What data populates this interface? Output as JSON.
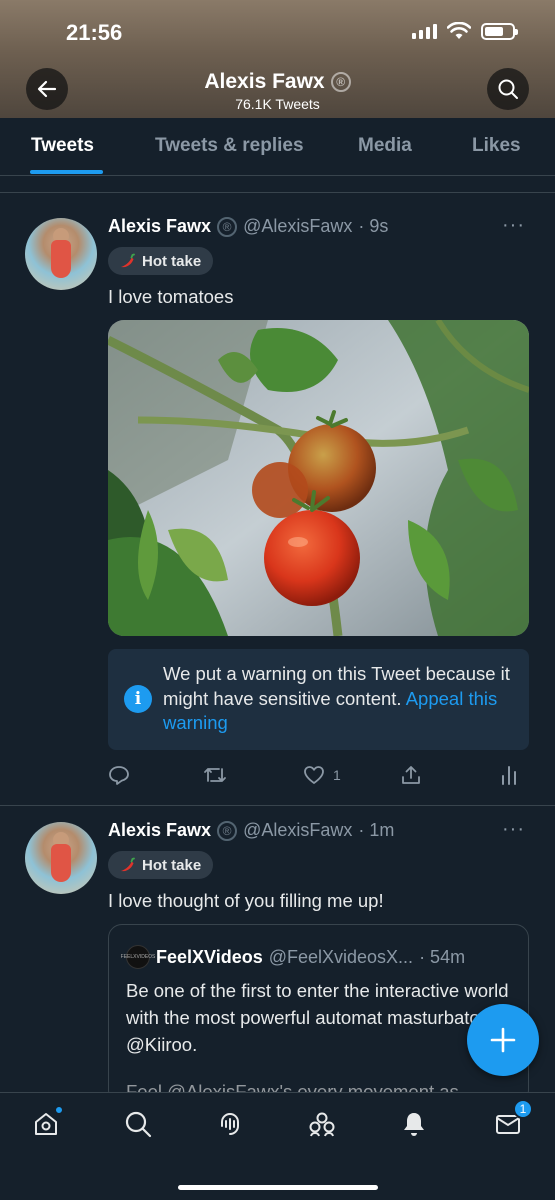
{
  "status_bar": {
    "time": "21:56"
  },
  "header": {
    "profile_name": "Alexis Fawx",
    "verified_mark": "®",
    "tweet_count": "76.1K Tweets"
  },
  "tabs": [
    {
      "label": "Tweets",
      "active": true
    },
    {
      "label": "Tweets & replies",
      "active": false
    },
    {
      "label": "Media",
      "active": false
    },
    {
      "label": "Likes",
      "active": false
    }
  ],
  "tweets": [
    {
      "name": "Alexis Fawx",
      "reg_mark": "®",
      "handle": "@AlexisFawx",
      "time": "· 9s",
      "more": "···",
      "label": "Hot take",
      "text": "I love tomatoes",
      "media_description_icon": "tomato-photo",
      "warning": {
        "text": "We put a warning on this Tweet because it might have sensitive content.",
        "link": "Appeal this warning"
      },
      "actions": {
        "reply_count": "",
        "retweet_count": "",
        "like_count": "1"
      }
    },
    {
      "name": "Alexis Fawx",
      "reg_mark": "®",
      "handle": "@AlexisFawx",
      "time": "· 1m",
      "more": "···",
      "label": "Hot take",
      "text": "I love thought of you filling me up!",
      "quote": {
        "avatar_text": "FEELXVIDEOS",
        "name": "FeelXVideos",
        "handle": "@FeelXvideosX...",
        "time": "· 54m",
        "body": "Be one of the first to enter the interactive world with the most powerful automat masturbator by @Kiiroo.",
        "faded": "Feel @AlexisFawx's every movement as"
      }
    }
  ],
  "fab": {
    "icon": "plus-icon"
  },
  "bottom_nav": {
    "items": [
      "home-icon",
      "search-icon",
      "spaces-icon",
      "communities-icon",
      "notifications-icon",
      "messages-icon"
    ],
    "messages_badge": "1"
  },
  "colors": {
    "accent": "#1d9bf0",
    "background": "#15202b",
    "divider": "#38444d"
  }
}
